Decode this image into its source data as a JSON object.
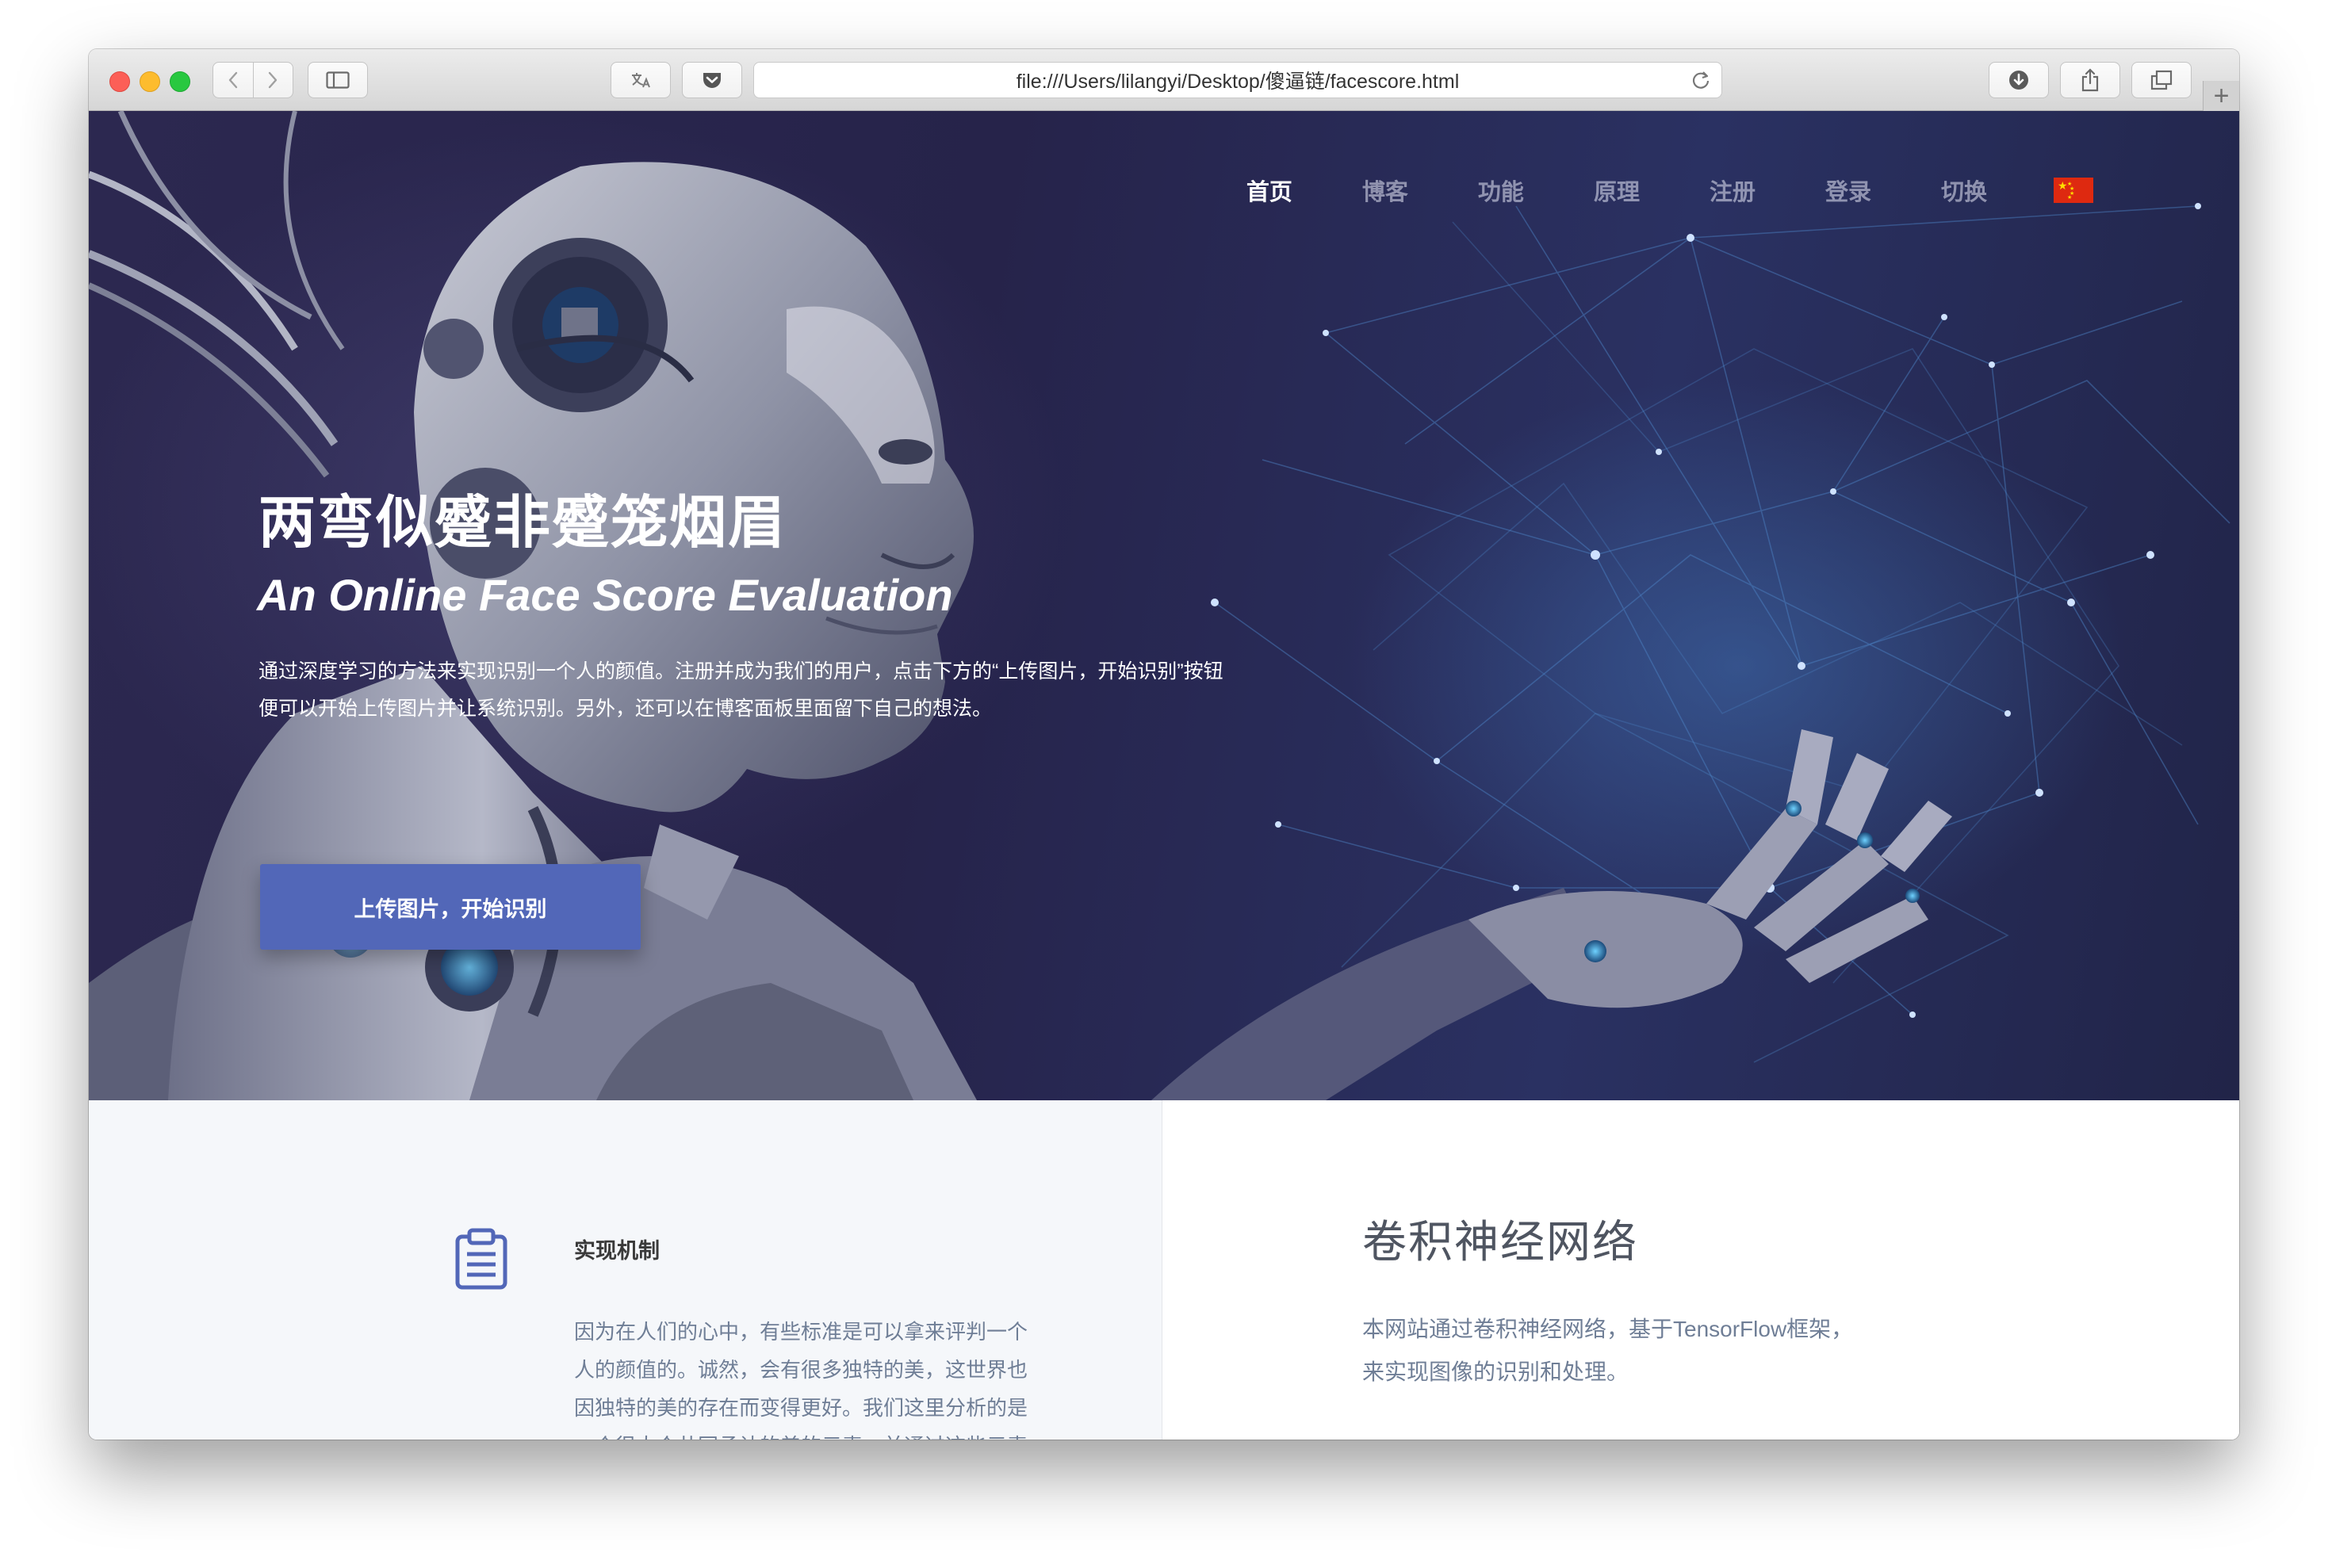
{
  "browser": {
    "url": "file:///Users/lilangyi/Desktop/傻逼链/facescore.html",
    "new_tab_symbol": "+"
  },
  "nav": {
    "items": [
      {
        "label": "首页",
        "active": true
      },
      {
        "label": "博客",
        "active": false
      },
      {
        "label": "功能",
        "active": false
      },
      {
        "label": "原理",
        "active": false
      },
      {
        "label": "注册",
        "active": false
      },
      {
        "label": "登录",
        "active": false
      },
      {
        "label": "切换",
        "active": false
      }
    ],
    "flag_icon": "china-flag-icon"
  },
  "hero": {
    "title": "两弯似蹙非蹙笼烟眉",
    "subtitle": "An Online Face Score Evaluation",
    "description": "通过深度学习的方法来实现识别一个人的颜值。注册并成为我们的用户，点击下方的“上传图片，开始识别”按钮便可以开始上传图片并让系统识别。另外，还可以在博客面板里面留下自己的想法。",
    "cta_label": "上传图片，开始识别"
  },
  "feature": {
    "icon": "clipboard-icon",
    "title": "实现机制",
    "text": "因为在人们的心中，有些标准是可以拿来评判一个人的颜值的。诚然，会有很多独特的美，这世界也因独特的美的存在而变得更好。我们这里分析的是一个很大众共同承认的美的元素，并通过这些元素来评判一个人的颜值。"
  },
  "cnn": {
    "title": "卷积神经网络",
    "text_line1": "本网站通过卷积神经网络，基于TensorFlow框架，",
    "text_line2": "来实现图像的识别和处理。"
  },
  "colors": {
    "hero_bg": "#26234a",
    "accent": "#5267b8",
    "body_text": "#6f7e96"
  }
}
